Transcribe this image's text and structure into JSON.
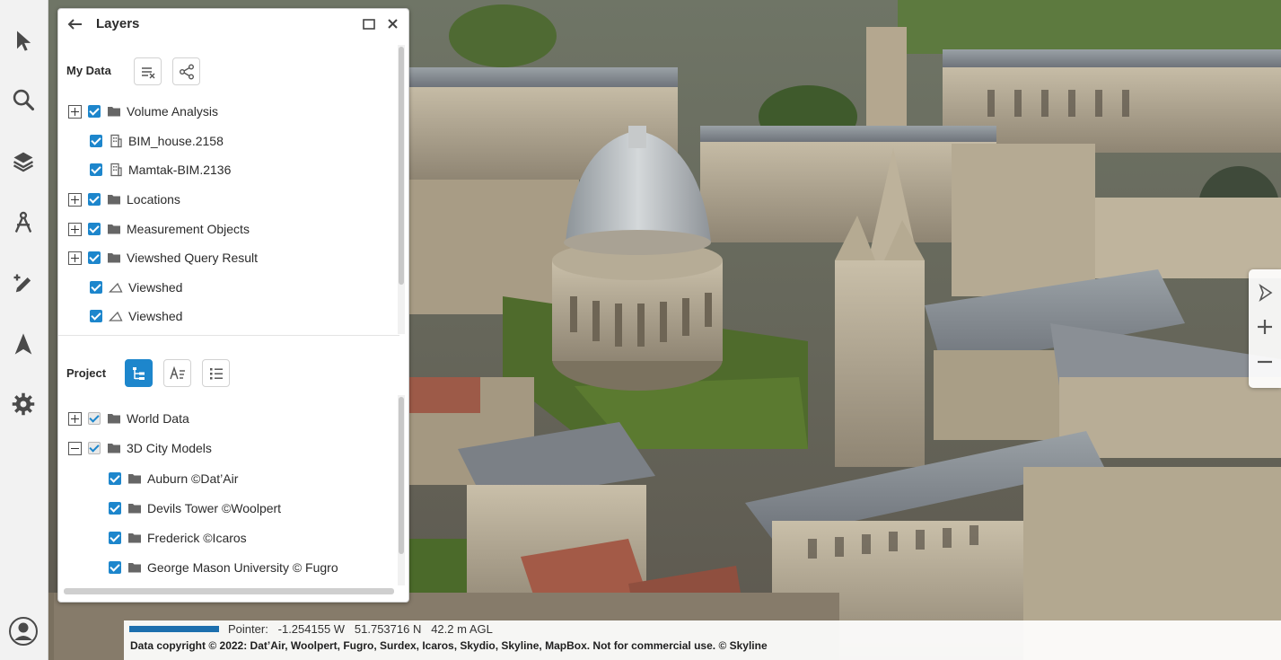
{
  "panel": {
    "title": "Layers",
    "back_icon": "arrow-left-icon",
    "maximize_icon": "window-maximize-icon",
    "close_icon": "close-icon"
  },
  "my_data": {
    "label": "My Data",
    "buttons": [
      {
        "name": "clear-list-icon"
      },
      {
        "name": "share-icon"
      }
    ],
    "items": [
      {
        "label": "Volume Analysis",
        "expander": "plus",
        "icon": "folder-icon",
        "checked": true
      },
      {
        "label": "BIM_house.2158",
        "expander": null,
        "icon": "building-icon",
        "checked": true
      },
      {
        "label": "Mamtak-BIM.2136",
        "expander": null,
        "icon": "building-icon",
        "checked": true
      },
      {
        "label": "Locations",
        "expander": "plus",
        "icon": "folder-icon",
        "checked": true
      },
      {
        "label": "Measurement Objects",
        "expander": "plus",
        "icon": "folder-icon",
        "checked": true
      },
      {
        "label": "Viewshed Query Result",
        "expander": "plus",
        "icon": "folder-icon",
        "checked": true
      },
      {
        "label": "Viewshed",
        "expander": null,
        "icon": "viewshed-icon",
        "checked": true
      },
      {
        "label": "Viewshed",
        "expander": null,
        "icon": "viewshed-icon",
        "checked": true
      }
    ]
  },
  "project": {
    "label": "Project",
    "buttons": [
      {
        "name": "tree-view-icon",
        "active": true
      },
      {
        "name": "sort-alpha-icon",
        "active": false
      },
      {
        "name": "list-view-icon",
        "active": false
      }
    ],
    "items": [
      {
        "label": "World Data",
        "expander": "plus",
        "icon": "folder-icon",
        "checked": "partial"
      },
      {
        "label": "3D City Models",
        "expander": "minus",
        "icon": "folder-icon",
        "checked": "partial"
      },
      {
        "label": "Auburn ©Dat’Air",
        "expander": null,
        "icon": "folder-icon",
        "checked": true
      },
      {
        "label": "Devils Tower ©Woolpert",
        "expander": null,
        "icon": "folder-icon",
        "checked": true
      },
      {
        "label": "Frederick ©Icaros",
        "expander": null,
        "icon": "folder-icon",
        "checked": true
      },
      {
        "label": "George Mason University © Fugro",
        "expander": null,
        "icon": "folder-icon",
        "checked": true
      }
    ]
  },
  "rail": [
    "cursor-icon",
    "search-icon",
    "layers-icon",
    "measure-icon",
    "draw-icon",
    "navigate-icon",
    "settings-icon",
    "user-icon"
  ],
  "nav": [
    "compass-icon",
    "zoom-in-icon",
    "zoom-out-icon"
  ],
  "status": {
    "pointer": "Pointer:   -1.254155 W   51.753716 N   42.2 m AGL",
    "copyright": "Data copyright © 2022: Dat’Air, Woolpert, Fugro, Surdex, Icaros, Skydio, Skyline, MapBox. Not for commercial use. © Skyline"
  },
  "colors": {
    "accent": "#1d86cc",
    "panel_bg": "#ffffff",
    "rail_bg": "#f2f2f2",
    "scale_bar": "#1d6fae"
  }
}
